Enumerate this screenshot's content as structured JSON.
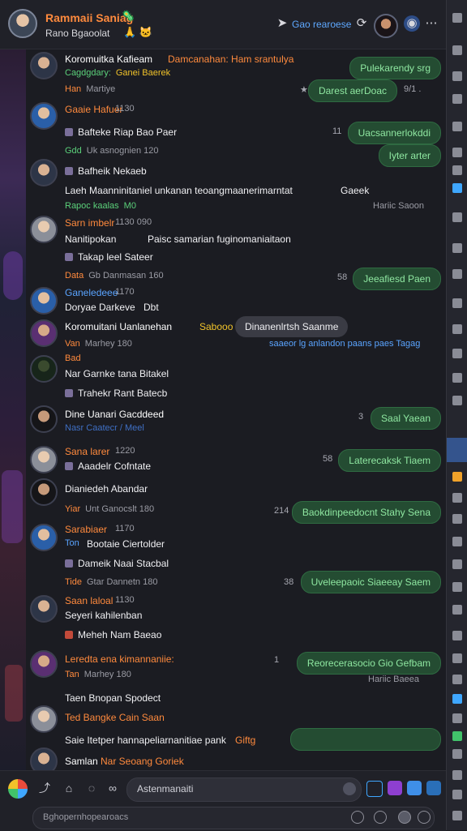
{
  "header": {
    "title": "Rammaii Saniag",
    "title_emoji": "🦠",
    "subtitle": "Rano Bgaoolat",
    "subtitle_emoji": "🙏 🐱",
    "status": "Gao rearoese",
    "status_icon": "send-arrow-icon"
  },
  "messages": [
    {
      "name": "Koromuitka Kafieam",
      "text": "Damcanahan: Ham srantulya",
      "meta_tag": "Cagdgdary:",
      "meta": "Ganei Baerek",
      "bubble_out": "Pulekarendy srg",
      "bubble_time": "9/1 ."
    },
    {
      "meta_tag": "Han",
      "meta": "Martiye",
      "bubble_out": "Darest aerDoac"
    },
    {
      "name": "Gaaie Hafuer",
      "name_time": "1130",
      "text": "Bafteke Riap Bao Paer",
      "right_num": "11",
      "bubble_out": "Uacsannerlokddi",
      "bubble_out2": "Iyter arter"
    },
    {
      "meta_tag": "Gdd",
      "meta": "Uk asnognien 120",
      "text": "Bafheik Nekaeb",
      "text2": "Laeh Maanninitaniel unkanan teoangmaanerimarntat",
      "text2_tail": "Gaeek",
      "meta2_tag": "Rapoc kaalas",
      "meta2": "M0",
      "link": "Hariic Saoon"
    },
    {
      "name": "Sarn imbelr",
      "name_time": "1130 090",
      "text": "Nanitipokan",
      "text_tail": "Paisc samarian fuginomaniaitaon",
      "text2": "Takap leel Sateer"
    },
    {
      "meta_tag": "Data",
      "meta": "Gb Danmasan 160",
      "right_num": "58",
      "bubble_out": "Jeeafiesd Paen"
    },
    {
      "name": "Ganeledeee",
      "name_time": "1170",
      "text": "Doryae Darkeve",
      "text_tail": "Dbt"
    },
    {
      "name": "Koromuitani Uanlanehan",
      "text_tail": "Sabooo",
      "bubble_in": "Dinanenlrtsh Saanme",
      "meta_tag": "Van",
      "meta": "Marhey 180",
      "link": "saaeor lg anlandon paans paes Tagag"
    },
    {
      "meta_tag": "Bad",
      "meta": "",
      "text": "Nar Garnke tana Bitakel",
      "text2": "Trahekr Rant Batecb"
    },
    {
      "name": "Dine Uanari Gacddeed",
      "meta": "Nasr Caatecr / Meel",
      "right_num": "3",
      "bubble_out": "Saal Yaean"
    },
    {
      "name": "Sana larer",
      "name_time": "1220",
      "text": "Aaadelr Cofntate",
      "right_num": "58",
      "bubble_out": "Laterecaksk Tiaem"
    },
    {
      "text": "Dianiedeh Abandar",
      "meta_tag": "Yiar",
      "meta": "Unt Ganocslt 180",
      "right_num": "214",
      "bubble_out": "Baokdinpeedocnt Stahy Sena"
    },
    {
      "name": "Sarabiaer",
      "name_time": "1170",
      "text": "Bootaie Ciertolder",
      "meta_tag": "Ton",
      "text2": "Dameik Naai Stacbal",
      "meta2_tag": "Tide",
      "meta2": "Gtar Dannetn 180",
      "right_num": "38",
      "bubble_out": "Uveleepaoic Siaeeay Saem"
    },
    {
      "name": "Saan laloal",
      "name_time": "1130",
      "text": "Seyeri kahilenban",
      "text2": "Meheh Nam Baeao"
    },
    {
      "name": "Leredta ena kimannaniie:",
      "meta_tag": "Tan",
      "meta": "Marhey 180",
      "right_num": "1",
      "bubble_out": "Reorecerasocio Gio Gefbam",
      "link": "Hariic Baeea"
    },
    {
      "text": "Taen Bnopan Spodect",
      "name": "Ted Bangke Cain Saan",
      "text2": "Saie Itetper hannapeliarnanitiae pank",
      "text2_tail": "Giftg"
    },
    {
      "name": "Samlan",
      "text": "Nar Seoang Goriek"
    }
  ],
  "composer": {
    "placeholder": "Astenmanaiti",
    "placeholder2": "Bghopernhopearoacs"
  }
}
